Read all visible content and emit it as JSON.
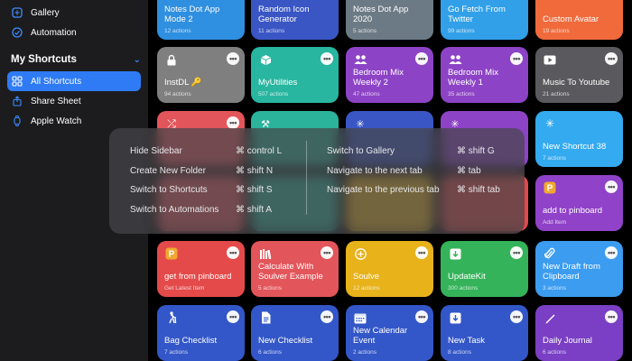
{
  "sidebar": {
    "items_top": [
      {
        "label": "Gallery",
        "icon": "gallery-icon"
      },
      {
        "label": "Automation",
        "icon": "automation-icon"
      }
    ],
    "section_title": "My Shortcuts",
    "items": [
      {
        "label": "All Shortcuts",
        "icon": "grid-icon",
        "active": true
      },
      {
        "label": "Share Sheet",
        "icon": "share-icon"
      },
      {
        "label": "Apple Watch",
        "icon": "watch-icon"
      }
    ]
  },
  "shortcuts": [
    {
      "name": "Notes Dot App Mode 2",
      "sub": "12 actions",
      "color": "#2f8fe0"
    },
    {
      "name": "Random Icon Generator",
      "sub": "11 actions",
      "color": "#3a56c4"
    },
    {
      "name": "Notes Dot App 2020",
      "sub": "5 actions",
      "color": "#6c7a85"
    },
    {
      "name": "Go Fetch From Twitter",
      "sub": "99 actions",
      "color": "#31a0e8"
    },
    {
      "name": "Custom Avatar",
      "sub": "19 actions",
      "color": "#f06a3c"
    },
    {
      "name": "InstDL 🔑",
      "sub": "94 actions",
      "color": "#7f7f80"
    },
    {
      "name": "MyUtilities",
      "sub": "507 actions",
      "color": "#28b6a0"
    },
    {
      "name": "Bedroom Mix Weekly 2",
      "sub": "47 actions",
      "color": "#8d43c6"
    },
    {
      "name": "Bedroom Mix Weekly 1",
      "sub": "35 actions",
      "color": "#8d43c6"
    },
    {
      "name": "Music To Youtube",
      "sub": "21 actions",
      "color": "#5a5a5e"
    },
    {
      "name": "New Shortcut 38",
      "sub": "7 actions",
      "color": "#34aaf0"
    },
    {
      "name": "add to pinboard",
      "sub": "Add Item",
      "color": "#9042c8"
    },
    {
      "name": "get from pinboard",
      "sub": "Get Latest Item",
      "color": "#e44a4a"
    },
    {
      "name": "Calculate With Soulver Example",
      "sub": "5 actions",
      "color": "#e2555a"
    },
    {
      "name": "Soulve",
      "sub": "12 actions",
      "color": "#e7b21a"
    },
    {
      "name": "UpdateKit",
      "sub": "300 actions",
      "color": "#35b35a"
    },
    {
      "name": "New Draft from Clipboard",
      "sub": "3 actions",
      "color": "#3b9cf0"
    },
    {
      "name": "Bag Checklist",
      "sub": "7 actions",
      "color": "#3357c8"
    },
    {
      "name": "New Checklist",
      "sub": "6 actions",
      "color": "#3357c8"
    },
    {
      "name": "New Calendar Event",
      "sub": "2 actions",
      "color": "#3357c8"
    },
    {
      "name": "New Task",
      "sub": "8 actions",
      "color": "#3357c8"
    },
    {
      "name": "Daily Journal",
      "sub": "6 actions",
      "color": "#7a3fc4"
    }
  ],
  "hidden_tiles_colors": [
    "#e2555a",
    "#2bb39b",
    "#3a56c4",
    "#8d43c6"
  ],
  "keyboard_shortcuts": {
    "left": [
      {
        "label": "Hide Sidebar",
        "key": "⌘ control L"
      },
      {
        "label": "Create New Folder",
        "key": "⌘ shift N"
      },
      {
        "label": "Switch to Shortcuts",
        "key": "⌘ shift S"
      },
      {
        "label": "Switch to Automations",
        "key": "⌘ shift A"
      }
    ],
    "right": [
      {
        "label": "Switch to Gallery",
        "key": "⌘ shift G"
      },
      {
        "label": "Navigate to the next tab",
        "key": "⌘ tab"
      },
      {
        "label": "Navigate to the previous tab",
        "key": "⌘ shift tab"
      }
    ]
  }
}
